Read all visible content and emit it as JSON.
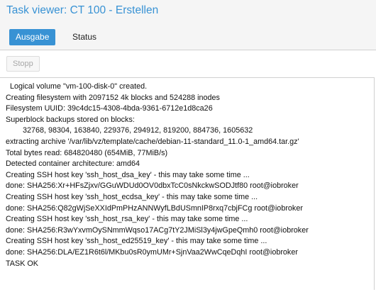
{
  "window": {
    "title": "Task viewer: CT 100 - Erstellen"
  },
  "tabs": [
    {
      "label": "Ausgabe",
      "active": true
    },
    {
      "label": "Status",
      "active": false
    }
  ],
  "toolbar": {
    "stop_label": "Stopp"
  },
  "log": {
    "lines": [
      "  Logical volume \"vm-100-disk-0\" created.",
      "Creating filesystem with 2097152 4k blocks and 524288 inodes",
      "Filesystem UUID: 39c4dc15-4308-4bda-9361-6712e1d8ca26",
      "Superblock backups stored on blocks:",
      "        32768, 98304, 163840, 229376, 294912, 819200, 884736, 1605632",
      "extracting archive '/var/lib/vz/template/cache/debian-11-standard_11.0-1_amd64.tar.gz'",
      "Total bytes read: 684820480 (654MiB, 77MiB/s)",
      "Detected container architecture: amd64",
      "Creating SSH host key 'ssh_host_dsa_key' - this may take some time ...",
      "done: SHA256:Xr+HFsZjxv/GGuWDUd0OV0dbxTcC0sNkckwSODJtf80 root@iobroker",
      "Creating SSH host key 'ssh_host_ecdsa_key' - this may take some time ...",
      "done: SHA256:Q82gWjSeXXIdPmPHzANNWyfLBdUSmnIP8rxq7cbjFCg root@iobroker",
      "Creating SSH host key 'ssh_host_rsa_key' - this may take some time ...",
      "done: SHA256:R3wYxvmOySNmmWqso17ACg7tY2JMiSl3y4jwGpeQmh0 root@iobroker",
      "Creating SSH host key 'ssh_host_ed25519_key' - this may take some time ...",
      "done: SHA256:DLA/EZ1R6t6l/MKbu0sR0ymUMr+SjnVaa2WwCqeDqhI root@iobroker",
      "TASK OK"
    ]
  },
  "colors": {
    "accent": "#3892d4",
    "background": "#f5f5f5",
    "panel": "#ffffff"
  }
}
